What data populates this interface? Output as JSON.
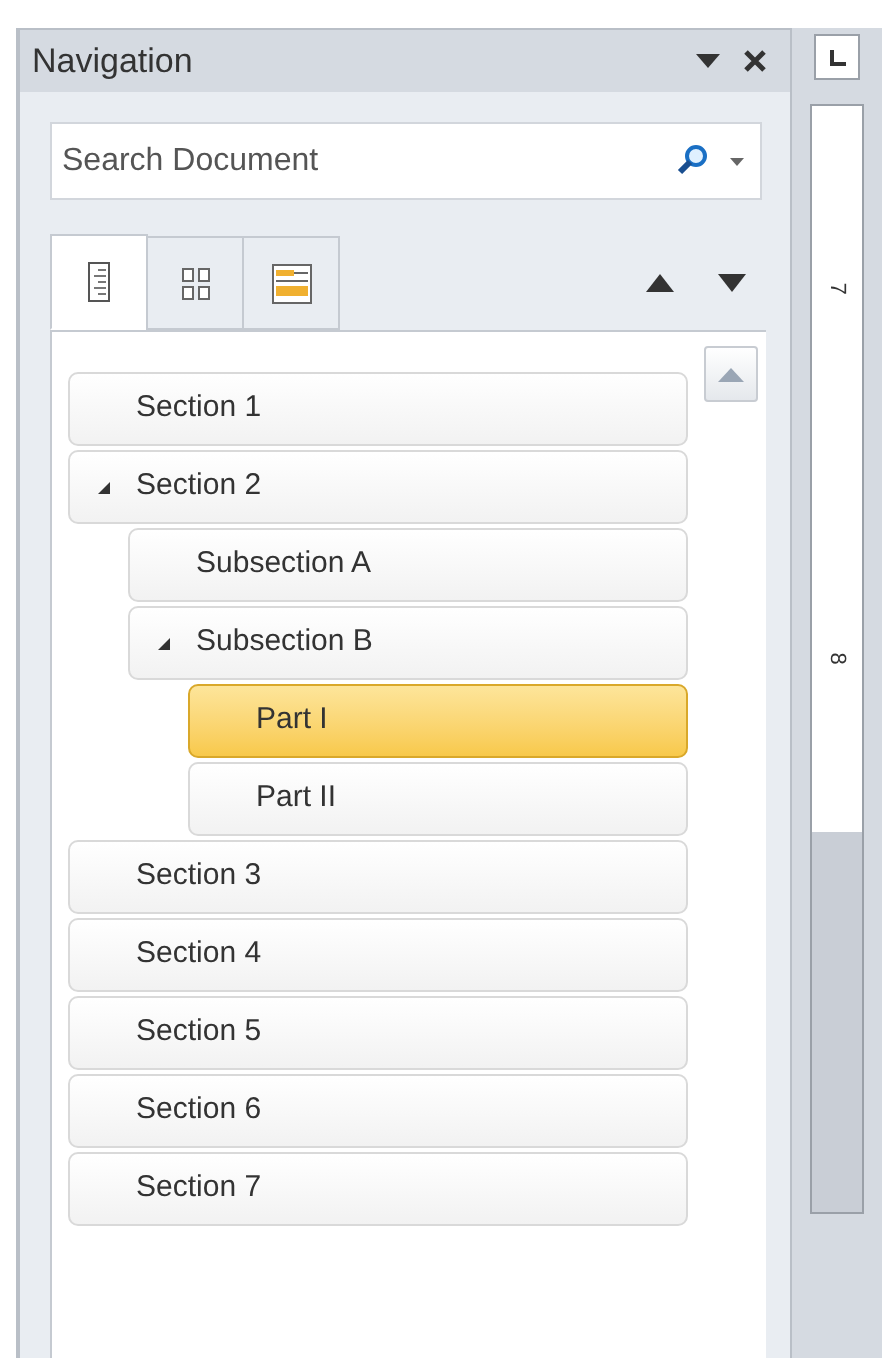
{
  "pane": {
    "title": "Navigation"
  },
  "search": {
    "placeholder": "Search Document"
  },
  "tabs": [
    {
      "kind": "headings",
      "selected": true
    },
    {
      "kind": "pages",
      "selected": false
    },
    {
      "kind": "results",
      "selected": false
    }
  ],
  "tree": [
    {
      "label": "Section 1",
      "selected": false
    },
    {
      "label": "Section 2",
      "selected": false,
      "expanded": true,
      "children": [
        {
          "label": "Subsection A",
          "selected": false
        },
        {
          "label": "Subsection B",
          "selected": false,
          "expanded": true,
          "children": [
            {
              "label": "Part I",
              "selected": true
            },
            {
              "label": "Part II",
              "selected": false
            }
          ]
        }
      ]
    },
    {
      "label": "Section 3",
      "selected": false
    },
    {
      "label": "Section 4",
      "selected": false
    },
    {
      "label": "Section 5",
      "selected": false
    },
    {
      "label": "Section 6",
      "selected": false
    },
    {
      "label": "Section 7",
      "selected": false
    }
  ],
  "ruler": {
    "labels": [
      "7",
      "8"
    ]
  }
}
